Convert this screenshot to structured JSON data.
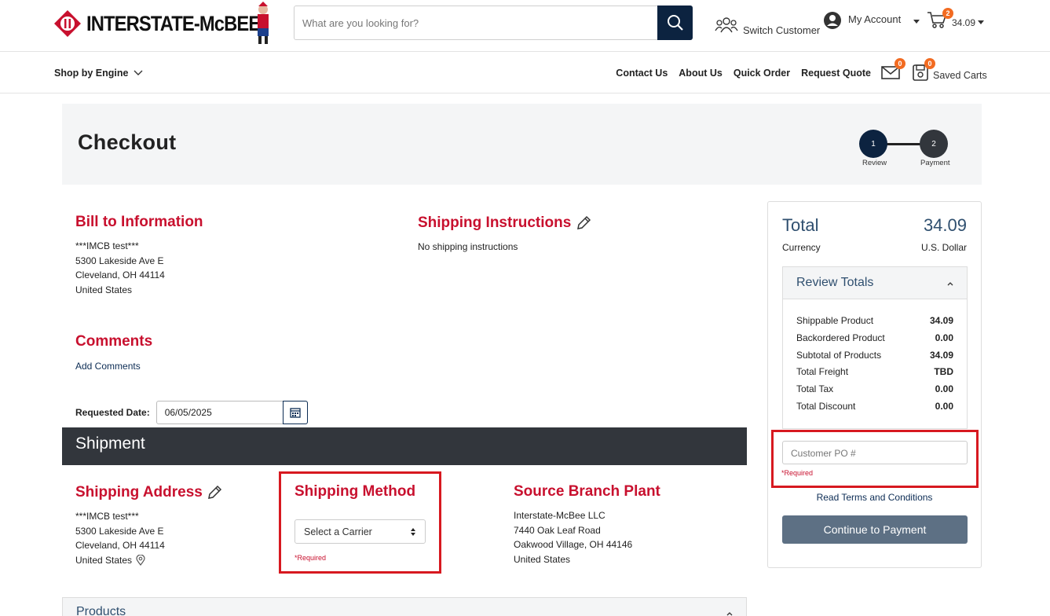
{
  "header": {
    "logo_text": "INTERSTATE-McBEE",
    "search_placeholder": "What are you looking for?",
    "switch_customer": "Switch Customer",
    "my_account": "My Account",
    "cart_count": "2",
    "cart_total": "34.09"
  },
  "nav": {
    "shop_by_engine": "Shop by Engine",
    "links": [
      "Contact Us",
      "About Us",
      "Quick Order",
      "Request Quote"
    ],
    "messages_count": "0",
    "saved_carts_count": "0",
    "saved_carts": "Saved Carts"
  },
  "checkout": {
    "title": "Checkout",
    "steps": [
      {
        "num": "1",
        "label": "Review"
      },
      {
        "num": "2",
        "label": "Payment"
      }
    ]
  },
  "bill_to": {
    "title": "Bill to Information",
    "lines": [
      "***IMCB test***",
      "5300 Lakeside Ave E",
      "Cleveland, OH 44114",
      "United States"
    ]
  },
  "shipping_instructions": {
    "title": "Shipping Instructions",
    "text": "No shipping instructions"
  },
  "comments": {
    "title": "Comments",
    "add_link": "Add Comments"
  },
  "requested_date": {
    "label": "Requested Date:",
    "value": "06/05/2025"
  },
  "shipment": {
    "title": "Shipment",
    "shipping_address": {
      "title": "Shipping Address",
      "lines": [
        "***IMCB test***",
        "5300 Lakeside Ave E",
        "Cleveland, OH 44114",
        "United States"
      ]
    },
    "shipping_method": {
      "title": "Shipping Method",
      "select_value": "Select a Carrier",
      "required": "*Required"
    },
    "source_branch": {
      "title": "Source Branch Plant",
      "lines": [
        "Interstate-McBee LLC",
        "7440 Oak Leaf Road",
        "Oakwood Village, OH 44146",
        "United States"
      ]
    }
  },
  "products": {
    "title": "Products"
  },
  "summary": {
    "total_label": "Total",
    "total_value": "34.09",
    "currency_label": "Currency",
    "currency_value": "U.S. Dollar",
    "review_title": "Review Totals",
    "rows": [
      {
        "label": "Shippable Product",
        "value": "34.09"
      },
      {
        "label": "Backordered Product",
        "value": "0.00"
      },
      {
        "label": "Subtotal of Products",
        "value": "34.09"
      },
      {
        "label": "Total Freight",
        "value": "TBD"
      },
      {
        "label": "Total Tax",
        "value": "0.00"
      },
      {
        "label": "Total Discount",
        "value": "0.00"
      }
    ],
    "po_placeholder": "Customer PO #",
    "po_required": "*Required",
    "terms": "Read Terms and Conditions",
    "continue": "Continue to Payment"
  },
  "colors": {
    "brand_red": "#c8102e",
    "navy": "#0c2340",
    "highlight": "#d71920",
    "badge": "#f26b21",
    "button": "#5d7084"
  }
}
